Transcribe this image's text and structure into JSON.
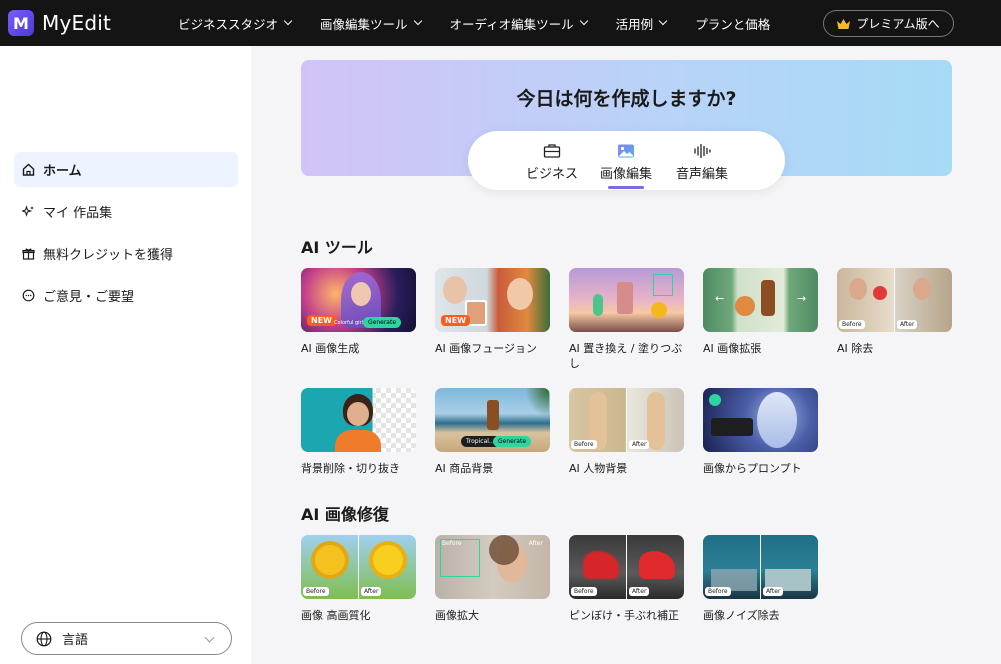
{
  "header": {
    "logo_text": "MyEdit",
    "nav": [
      {
        "label": "ビジネススタジオ"
      },
      {
        "label": "画像編集ツール"
      },
      {
        "label": "オーディオ編集ツール"
      },
      {
        "label": "活用例"
      },
      {
        "label": "プランと価格"
      }
    ],
    "premium_label": "プレミアム版へ"
  },
  "sidebar": {
    "items": [
      {
        "label": "ホーム",
        "icon": "home-icon"
      },
      {
        "label": "マイ 作品集",
        "icon": "sparkle-icon"
      },
      {
        "label": "無料クレジットを獲得",
        "icon": "gift-icon"
      },
      {
        "label": "ご意見・ご要望",
        "icon": "feedback-icon"
      }
    ],
    "language_label": "言語"
  },
  "hero": {
    "title": "今日は何を作成しますか?",
    "tabs": [
      {
        "label": "ビジネス",
        "icon": "briefcase-icon"
      },
      {
        "label": "画像編集",
        "icon": "image-icon"
      },
      {
        "label": "音声編集",
        "icon": "audio-wave-icon"
      }
    ]
  },
  "sections": {
    "ai_tools": {
      "title": "AI ツール",
      "cards": [
        {
          "label": "AI 画像生成",
          "badge": "NEW",
          "pill": "Colorful girl",
          "button": "Generate"
        },
        {
          "label": "AI 画像フュージョン",
          "badge": "NEW"
        },
        {
          "label": "AI 置き換え / 塗りつぶし"
        },
        {
          "label": "AI 画像拡張"
        },
        {
          "label": "AI 除去",
          "before": "Before",
          "after": "After"
        },
        {
          "label": "背景削除・切り抜き"
        },
        {
          "label": "AI 商品背景",
          "pill": "Tropical...",
          "button": "Generate"
        },
        {
          "label": "AI 人物背景",
          "before": "Before",
          "after": "After"
        },
        {
          "label": "画像からプロンプト"
        }
      ]
    },
    "ai_restore": {
      "title": "AI 画像修復",
      "cards": [
        {
          "label": "画像 高画質化",
          "before": "Before",
          "after": "After"
        },
        {
          "label": "画像拡大",
          "before": "Before",
          "after": "After"
        },
        {
          "label": "ピンぼけ・手ぶれ補正",
          "before": "Before",
          "after": "After"
        },
        {
          "label": "画像ノイズ除去",
          "before": "Before",
          "after": "After"
        }
      ]
    }
  },
  "colors": {
    "topbar": "#141414",
    "accent": "#7e67e9",
    "new_badge": "#ff5a1f",
    "generate_button": "#2bd6a0"
  }
}
